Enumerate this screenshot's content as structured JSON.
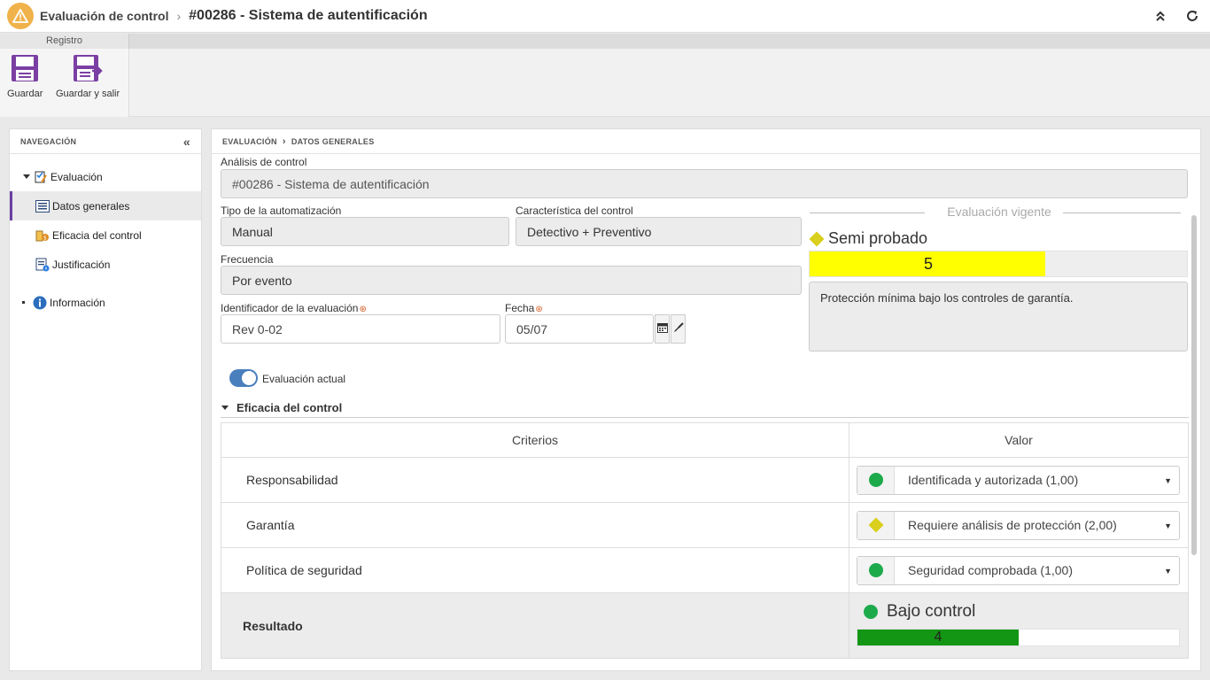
{
  "window": {
    "module": "Evaluación de control",
    "title": "#00286 - Sistema de autentificación"
  },
  "ribbon": {
    "tab": "Registro",
    "buttons": [
      {
        "label": "Guardar",
        "icon": "save-icon"
      },
      {
        "label": "Guardar y salir",
        "icon": "save-exit-icon"
      }
    ]
  },
  "nav": {
    "header": "NAVEGACIÓN",
    "items": [
      {
        "label": "Evaluación",
        "icon": "evaluation-icon"
      },
      {
        "label": "Datos generales",
        "icon": "list-icon"
      },
      {
        "label": "Eficacia del control",
        "icon": "effectiveness-icon"
      },
      {
        "label": "Justificación",
        "icon": "justification-icon"
      },
      {
        "label": "Información",
        "icon": "info-icon"
      }
    ]
  },
  "breadcrumb": [
    "EVALUACIÓN",
    "DATOS GENERALES"
  ],
  "form": {
    "analisis_label": "Análisis de control",
    "analisis_value": "#00286 - Sistema de autentificación",
    "tipo_label": "Tipo de la automatización",
    "tipo_value": "Manual",
    "caracteristica_label": "Característica del control",
    "caracteristica_value": "Detectivo + Preventivo",
    "frecuencia_label": "Frecuencia",
    "frecuencia_value": "Por evento",
    "identificador_label": "Identificador de la evaluación",
    "identificador_value": "Rev 0-02",
    "fecha_label": "Fecha",
    "fecha_value": "05/07"
  },
  "evaluacion_vigente": {
    "title": "Evaluación vigente",
    "status": "Semi probado",
    "score": "5",
    "score_fraction": 0.625,
    "bar_color": "#ffff00",
    "description": "Protección mínima bajo los controles de garantía."
  },
  "toggle": {
    "label": "Evaluación actual",
    "on": true
  },
  "eficacia": {
    "title": "Eficacia del control",
    "col_criterios": "Criterios",
    "col_valor": "Valor",
    "rows": [
      {
        "criterio": "Responsabilidad",
        "valor": "Identificada y autorizada (1,00)",
        "indicator": "green-dot"
      },
      {
        "criterio": "Garantía",
        "valor": "Requiere análisis de protección (2,00)",
        "indicator": "yellow-diamond"
      },
      {
        "criterio": "Política de seguridad",
        "valor": "Seguridad comprobada (1,00)",
        "indicator": "green-dot"
      }
    ],
    "resultado_label": "Resultado",
    "resultado_status": "Bajo control",
    "resultado_score": "4",
    "resultado_fraction": 0.5,
    "resultado_color": "#139613"
  },
  "colors": {
    "accent": "#6b3fa0",
    "toggle": "#4a7fbd",
    "green": "#1daa4b",
    "yellow": "#d9cf1c"
  }
}
